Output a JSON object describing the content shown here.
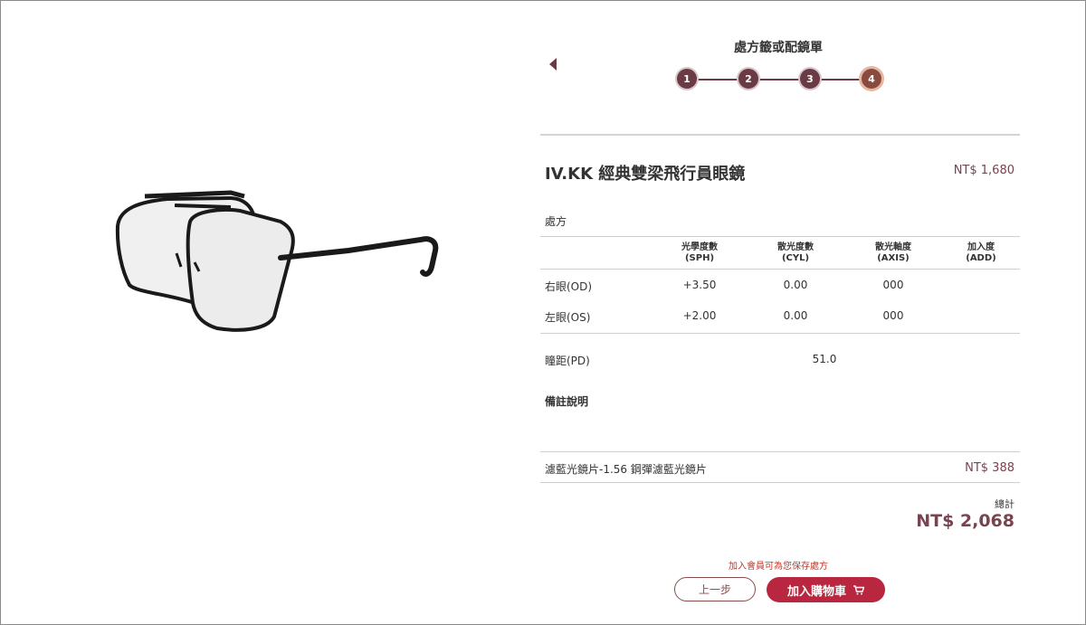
{
  "header": {
    "title": "處方籤或配鏡單"
  },
  "steps": [
    "1",
    "2",
    "3",
    "4"
  ],
  "product": {
    "name": "IV.KK 經典雙梁飛行員眼鏡",
    "price": "NT$ 1,680"
  },
  "prescription": {
    "section_label": "處方",
    "columns": [
      {
        "label": "光學度數",
        "sub": "(SPH)"
      },
      {
        "label": "散光度數",
        "sub": "(CYL)"
      },
      {
        "label": "散光軸度",
        "sub": "(AXIS)"
      },
      {
        "label": "加入度",
        "sub": "(ADD)"
      }
    ],
    "rows": [
      {
        "label": "右眼(OD)",
        "sph": "+3.50",
        "cyl": "0.00",
        "axis": "000",
        "add": ""
      },
      {
        "label": "左眼(OS)",
        "sph": "+2.00",
        "cyl": "0.00",
        "axis": "000",
        "add": ""
      }
    ],
    "pd_label": "瞳距(PD)",
    "pd_value": "51.0",
    "notes_label": "備註說明"
  },
  "lens": {
    "name": "濾藍光鏡片-1.56 鋼彈濾藍光鏡片",
    "price": "NT$ 388"
  },
  "total": {
    "label": "總計",
    "value": "NT$ 2,068"
  },
  "member_note": "加入會員可為您保存處方",
  "buttons": {
    "prev": "上一步",
    "add_to_cart": "加入購物車"
  },
  "icons": {
    "back": "back-arrow-icon",
    "cart": "cart-icon"
  },
  "colors": {
    "accent": "#6b3b45",
    "cta": "#b8273f",
    "price": "#7a4350"
  }
}
